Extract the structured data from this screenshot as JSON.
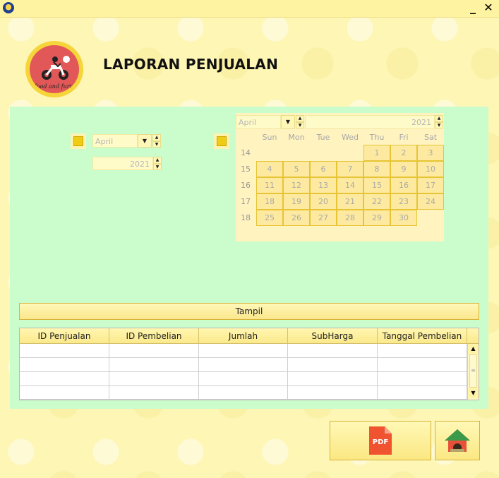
{
  "window": {
    "minimize_glyph": "_",
    "close_glyph": "✕"
  },
  "header": {
    "title": "LAPORAN PENJUALAN",
    "logo_text": "food and furious"
  },
  "filter_left": {
    "month": "April",
    "year": "2021"
  },
  "calendar": {
    "month": "April",
    "year": "2021",
    "weekdays": [
      "Sun",
      "Mon",
      "Tue",
      "Wed",
      "Thu",
      "Fri",
      "Sat"
    ],
    "week_numbers": [
      "14",
      "15",
      "16",
      "17",
      "18"
    ],
    "days": [
      "1",
      "2",
      "3",
      "4",
      "5",
      "6",
      "7",
      "8",
      "9",
      "10",
      "11",
      "12",
      "13",
      "14",
      "15",
      "16",
      "17",
      "18",
      "19",
      "20",
      "21",
      "22",
      "23",
      "24",
      "25",
      "26",
      "27",
      "28",
      "29",
      "30"
    ]
  },
  "actions": {
    "tampil_label": "Tampil"
  },
  "table": {
    "columns": [
      "ID Penjualan",
      "ID Pembelian",
      "Jumlah",
      "SubHarga",
      "Tanggal Pembelian"
    ],
    "rows": 4
  },
  "buttons": {
    "pdf_label": "PDF",
    "pdf_icon": "pdf-icon",
    "home_icon": "home-icon"
  },
  "colors": {
    "panel": "#cbfccc",
    "window": "#fdf6b5",
    "accent": "#f1cc14"
  }
}
